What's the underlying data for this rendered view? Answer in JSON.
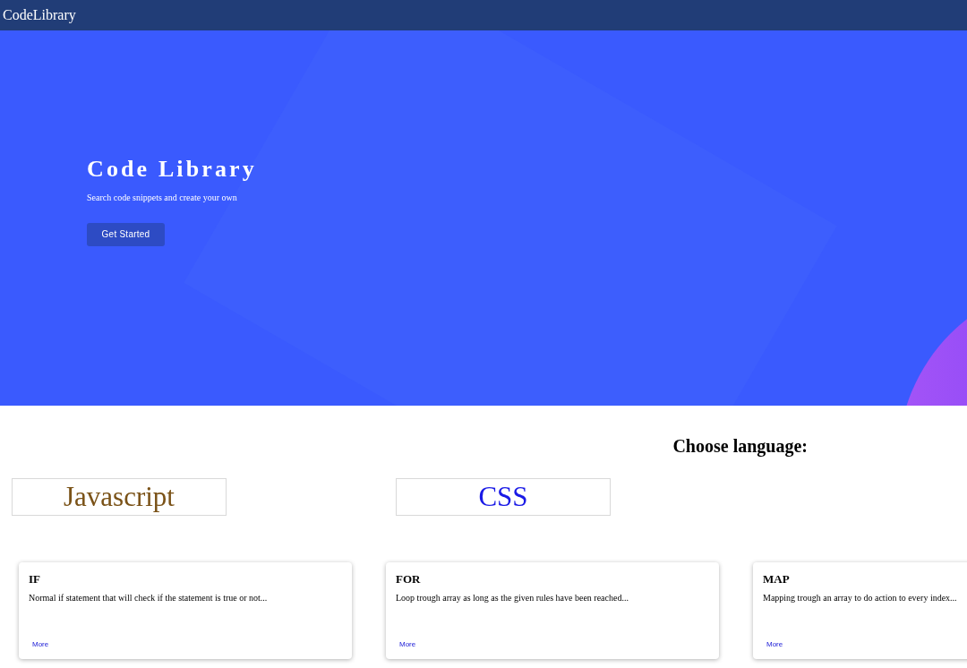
{
  "navbar": {
    "brand": "CodeLibrary"
  },
  "hero": {
    "title": "Code Library",
    "subtitle": "Search code snippets and create your own",
    "button": "Get Started"
  },
  "languages": {
    "heading": "Choose language:",
    "items": [
      {
        "label": "Javascript",
        "color": "#7a5217"
      },
      {
        "label": "CSS",
        "color": "#1a1ae6"
      }
    ]
  },
  "snippets": [
    {
      "title": "IF",
      "description": "Normal if statement that will check if the statement is true or not...",
      "link": "More"
    },
    {
      "title": "FOR",
      "description": "Loop trough array as long as the given rules have been reached...",
      "link": "More"
    },
    {
      "title": "MAP",
      "description": "Mapping trough an array to do action to every index...",
      "link": "More"
    }
  ]
}
